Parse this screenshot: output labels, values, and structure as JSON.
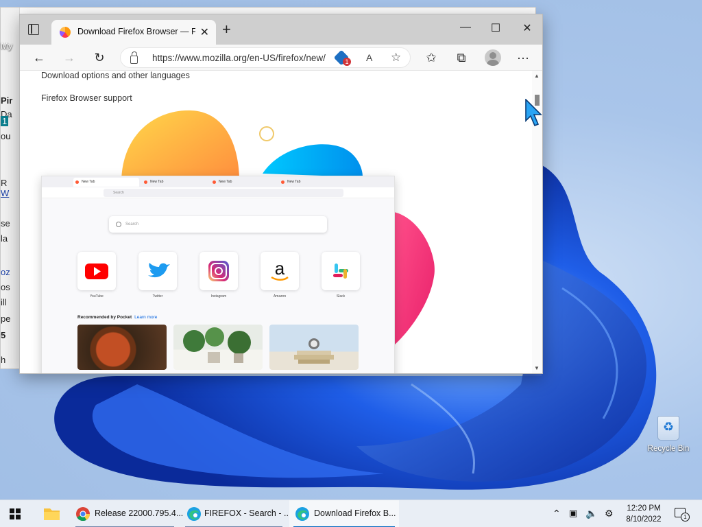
{
  "background_window": {
    "fragments": [
      "My",
      "Pir",
      "Da",
      "1",
      "ou",
      "R",
      "W",
      "se",
      "la",
      "oz",
      "os",
      "ill",
      "pe",
      "5",
      "h"
    ]
  },
  "browser": {
    "tab_title": "Download Firefox Browser — Fast, Private & Free — from Mozilla",
    "tab_close": "✕",
    "new_tab": "+",
    "minimize": "—",
    "maximize": "☐",
    "close": "✕",
    "url": "https://www.mozilla.org/en-US/firefox/new/",
    "extension_badge": "1",
    "read_aloud": "A",
    "menu": "···"
  },
  "page": {
    "links": [
      "Download options and other languages",
      "Firefox Browser support"
    ],
    "mock": {
      "tabs": [
        "New Tab",
        "New Tab",
        "New Tab",
        "New Tab"
      ],
      "url_placeholder": "Search",
      "search_placeholder": "Search",
      "tiles": [
        "YouTube",
        "Twitter",
        "Instagram",
        "Amazon",
        "Slack"
      ],
      "pocket_heading": "Recommended by Pocket",
      "pocket_learn_more": "Learn more"
    }
  },
  "desktop": {
    "recycle_bin": "Recycle Bin"
  },
  "taskbar": {
    "items": [
      {
        "label": "Release 22000.795.4..."
      },
      {
        "label": "FIREFOX - Search - ..."
      },
      {
        "label": "Download Firefox B..."
      }
    ],
    "time": "12:20 PM",
    "date": "8/10/2022",
    "notifications": "1"
  },
  "colors": {
    "accent": "#0067c0",
    "wallpaper_blue": "#1a4fd6"
  }
}
